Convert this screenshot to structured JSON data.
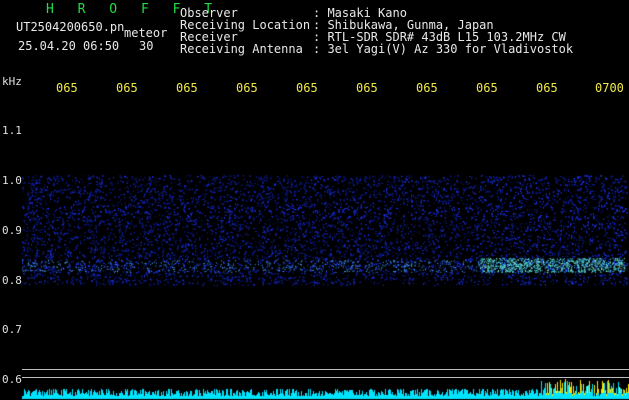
{
  "brand": "H R O F F T",
  "file": "UT2504200650.pn",
  "mode": "meteor",
  "datetime": "25.04.20 06:50",
  "count": "30",
  "meta": {
    "labels": [
      "Observer",
      "Receiving Location",
      "Receiver",
      "Receiving Antenna"
    ],
    "values": [
      ": Masaki Kano",
      ": Shibukawa, Gunma, Japan",
      ": RTL-SDR SDR# 43dB L15 103.2MHz CW",
      ": 3el Yagi(V) Az 330 for Vladivostok"
    ]
  },
  "time_ticks": [
    "065",
    "065",
    "065",
    "065",
    "065",
    "065",
    "065",
    "065",
    "065",
    "0700"
  ],
  "y_axis": {
    "unit": "kHz",
    "ticks": [
      "1.1",
      "1.0",
      "0.9",
      "0.8",
      "0.7",
      "0.6"
    ]
  },
  "colors": {
    "background": "#000000",
    "brand": "#22dd44",
    "ticks": "#f0e84a",
    "signal": "#1e3cff",
    "strong": "#7cffd0",
    "level": "#00e5ff",
    "peak": "#ffe600"
  }
}
